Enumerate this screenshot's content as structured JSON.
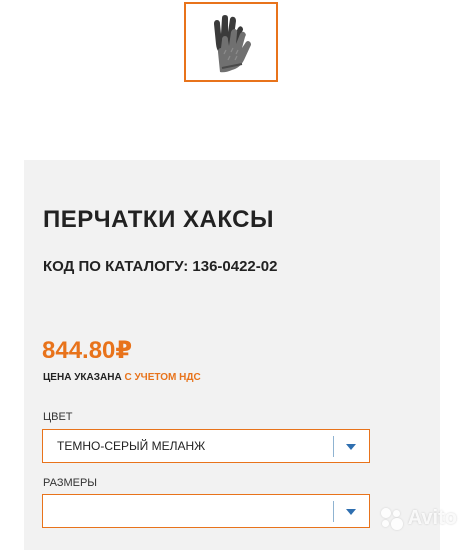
{
  "product": {
    "title": "ПЕРЧАТКИ ХАКСЫ",
    "catalog_code": "КОД ПО КАТАЛОГУ: 136-0422-02",
    "price": "844.80₽",
    "vat_note_prefix": "ЦЕНА УКАЗАНА ",
    "vat_note_accent": "С УЧЕТОМ НДС"
  },
  "options": {
    "color_label": "ЦВЕТ",
    "color_value": "ТЕМНО-СЕРЫЙ МЕЛАНЖ",
    "size_label": "РАЗМЕРЫ",
    "size_value": ""
  },
  "watermark": {
    "text": "Avito"
  },
  "icons": {
    "thumbnail": "gloves-image",
    "dropdown": "chevron-down-icon"
  },
  "colors": {
    "accent": "#e8731b",
    "panel_bg": "#f2f2f2",
    "dropdown_arrow": "#2f6fb0"
  }
}
